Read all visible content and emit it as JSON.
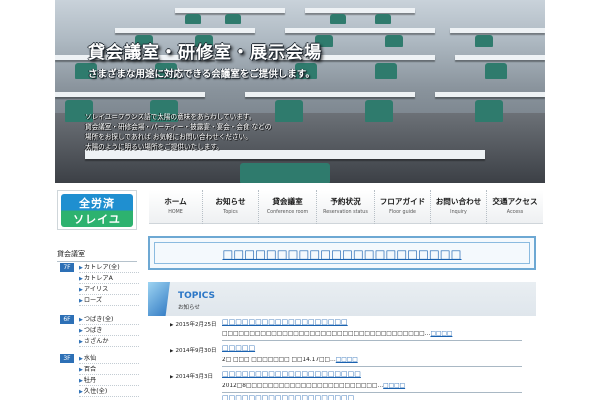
{
  "hero": {
    "title": "貸会議室・研修室・展示会場",
    "subtitle": "さまざまな用途に対応できる会議室をご提供します。",
    "desc": [
      "ソレイユ＝フランス語で太陽の意味をあらわしています。",
      "貸会議室・研修会場・パーティー・披露宴・宴会・会食 などの",
      "場所をお探しであれば お気軽にお問い合わせください。",
      "太陽のように明るい場所をご提供いたします。"
    ]
  },
  "logo": {
    "line1": "全労済",
    "line2": "ソレイユ"
  },
  "sidebar": {
    "heading": "貸会議室",
    "floors": [
      {
        "badge": "7F",
        "items": [
          "カトレア(全)",
          "カトレアA",
          "アイリス",
          "ローズ"
        ]
      },
      {
        "badge": "6F",
        "items": [
          "つばき(全)",
          "つばき",
          "さざんか"
        ]
      },
      {
        "badge": "3F",
        "items": [
          "水仙",
          "百合",
          "牡丹",
          "久住(全)"
        ]
      }
    ]
  },
  "nav": [
    {
      "jp": "ホーム",
      "en": "HOME"
    },
    {
      "jp": "お知らせ",
      "en": "Topics"
    },
    {
      "jp": "貸会議室",
      "en": "Conference room"
    },
    {
      "jp": "予約状況",
      "en": "Reservation status"
    },
    {
      "jp": "フロアガイド",
      "en": "Floor guide"
    },
    {
      "jp": "お問い合わせ",
      "en": "Inquiry"
    },
    {
      "jp": "交通アクセス",
      "en": "Access"
    }
  ],
  "banner": {
    "text": "□□□□□□□□□□□□□□□□□□□□□□"
  },
  "topics": {
    "title": "TOPICS",
    "subtitle": "お知らせ",
    "items": [
      {
        "date": "2015年2月25日",
        "title": "□□□□□□□□□□□□□□□□□□□",
        "body": "□□□□□□□□□□□□□□□□□□□□□□□□□□□□□□□□□□□□□…",
        "more": "□□□□"
      },
      {
        "date": "2014年9月30日",
        "title": "□□□□□",
        "body": "2□ □□□ □□□□□□□ □□14.17□□…",
        "more": "□□□□"
      },
      {
        "date": "2014年3月3日",
        "title": "□□□□□□□□□□□□□□□□□□□□□",
        "body": "2012□8□□□□□□□□□□□□□□□□□□□□□□□□…",
        "more": "□□□□"
      },
      {
        "date": "",
        "title": "□□□□□□□□□□□□□□□□□□□□",
        "body": "",
        "more": ""
      }
    ]
  }
}
